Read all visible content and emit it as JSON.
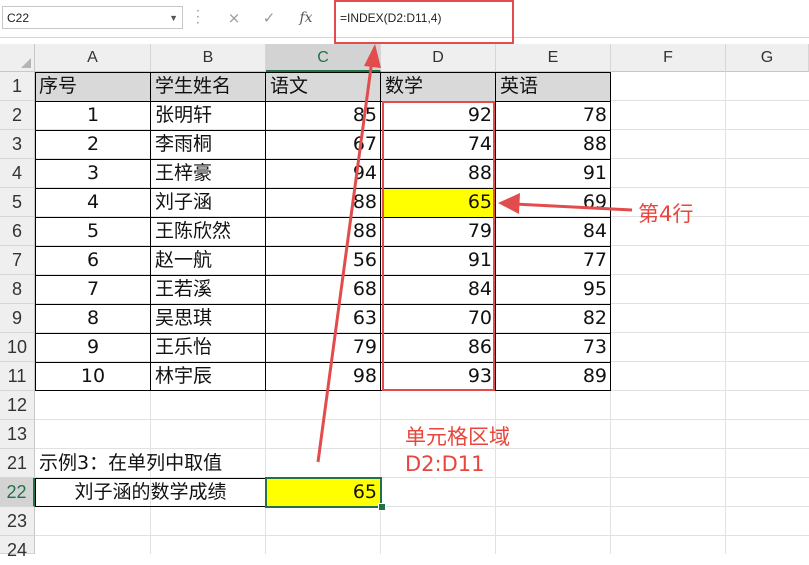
{
  "formula_bar": {
    "name_box": "C22",
    "cancel_icon": "×",
    "enter_icon": "✓",
    "fx_icon": "fx",
    "formula": "=INDEX(D2:D11,4)"
  },
  "sheet": {
    "columns": [
      "A",
      "B",
      "C",
      "D",
      "E",
      "F",
      "G"
    ],
    "selected_column": "C",
    "selected_row": "22",
    "row_labels": [
      "1",
      "2",
      "3",
      "4",
      "5",
      "6",
      "7",
      "8",
      "9",
      "10",
      "11",
      "12",
      "13",
      "21",
      "22",
      "23",
      "24"
    ],
    "header": [
      "序号",
      "学生姓名",
      "语文",
      "数学",
      "英语"
    ],
    "rows": [
      [
        "1",
        "张明轩",
        "85",
        "92",
        "78"
      ],
      [
        "2",
        "李雨桐",
        "67",
        "74",
        "88"
      ],
      [
        "3",
        "王梓豪",
        "94",
        "88",
        "91"
      ],
      [
        "4",
        "刘子涵",
        "88",
        "65",
        "69"
      ],
      [
        "5",
        "王陈欣然",
        "88",
        "79",
        "84"
      ],
      [
        "6",
        "赵一航",
        "56",
        "91",
        "77"
      ],
      [
        "7",
        "王若溪",
        "68",
        "84",
        "95"
      ],
      [
        "8",
        "吴思琪",
        "63",
        "70",
        "82"
      ],
      [
        "9",
        "王乐怡",
        "79",
        "86",
        "73"
      ],
      [
        "10",
        "林宇辰",
        "98",
        "93",
        "89"
      ]
    ],
    "example_label": "示例3：在单列中取值",
    "result_label": "刘子涵的数学成绩",
    "result_value": "65"
  },
  "annotations": {
    "row_note": "第4行",
    "range_note_line1": "单元格区域",
    "range_note_line2": "D2:D11"
  },
  "colors": {
    "annotation_red": "#e24c4c",
    "highlight_yellow": "#ffff00",
    "header_fill": "#d9d9d9",
    "selection_green": "#217346"
  }
}
